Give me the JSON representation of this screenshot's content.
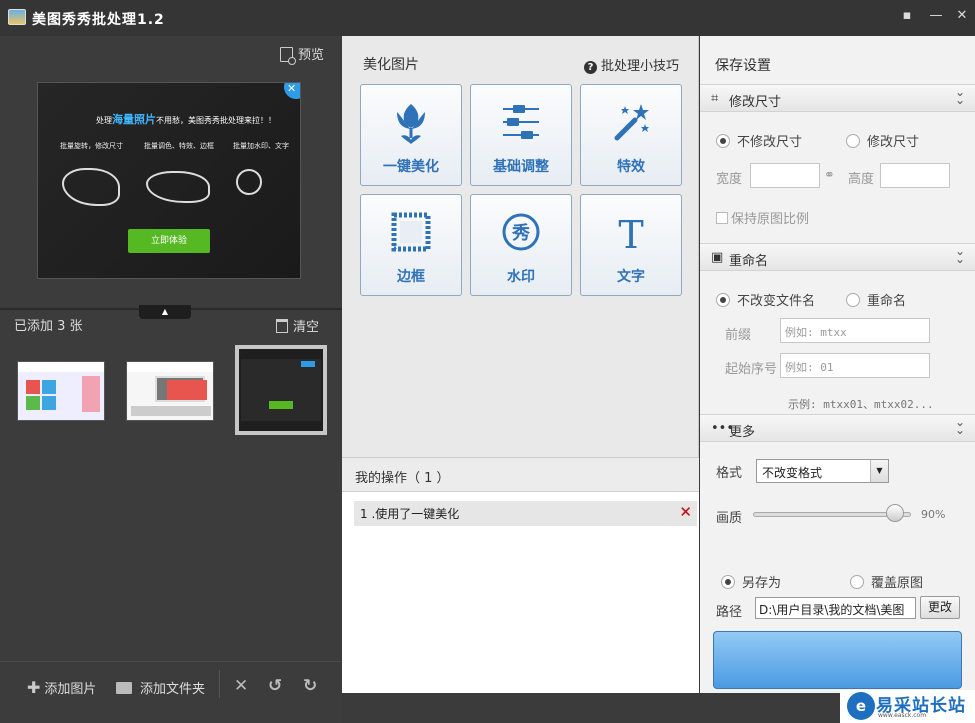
{
  "window": {
    "title": "美图秀秀批处理1.2"
  },
  "left": {
    "preview_label": "预览",
    "preview_image": {
      "headline_pre": "处理",
      "headline_em": "海量照片",
      "headline_post": "不用愁，美图秀秀批处理来拉！！",
      "col1": "批量旋转，修改尺寸",
      "col2": "批量调色、特效、边框",
      "col3": "批量加水印、文字",
      "try_button": "立即体验"
    },
    "added_count": "已添加 3 张",
    "clear_label": "清空",
    "bottom": {
      "add_image": "添加图片",
      "add_folder": "添加文件夹"
    }
  },
  "middle": {
    "title": "美化图片",
    "tips": "批处理小技巧",
    "tools": [
      {
        "label": "一键美化",
        "icon": "tulip-icon"
      },
      {
        "label": "基础调整",
        "icon": "sliders-icon"
      },
      {
        "label": "特效",
        "icon": "magic-wand-icon"
      },
      {
        "label": "边框",
        "icon": "frame-icon"
      },
      {
        "label": "水印",
        "icon": "xiu-stamp-icon"
      },
      {
        "label": "文字",
        "icon": "text-t-icon"
      }
    ],
    "ops_title": "我的操作（ 1 ）",
    "ops": [
      {
        "text": "1 .使用了一键美化"
      }
    ],
    "xiu_glyph": "秀",
    "t_glyph": "T"
  },
  "right": {
    "title": "保存设置",
    "resize": {
      "header": "修改尺寸",
      "opt_keep": "不修改尺寸",
      "opt_change": "修改尺寸",
      "width_label": "宽度",
      "height_label": "高度",
      "keep_ratio": "保持原图比例"
    },
    "rename": {
      "header": "重命名",
      "opt_keep": "不改变文件名",
      "opt_rename": "重命名",
      "prefix_label": "前缀",
      "prefix_placeholder": "例如: mtxx",
      "start_label": "起始序号",
      "start_placeholder": "例如: 01",
      "example": "示例: mtxx01、mtxx02..."
    },
    "more": {
      "header": "更多",
      "format_label": "格式",
      "format_value": "不改变格式",
      "quality_label": "画质",
      "quality_value": "90%",
      "quality_level": 0.9,
      "opt_saveas": "另存为",
      "opt_overwrite": "覆盖原图",
      "path_label": "路径",
      "path_value": "D:\\用户目录\\我的文档\\美图",
      "change_button": "更改"
    }
  },
  "watermark": {
    "name": "易采站长站",
    "url": "www.easck.com"
  },
  "colors": {
    "accent": "#2f72b8",
    "dark_bg": "#3c3c3c",
    "panel_bg": "#e9e9e9",
    "save_button": "#5aa5e6"
  }
}
